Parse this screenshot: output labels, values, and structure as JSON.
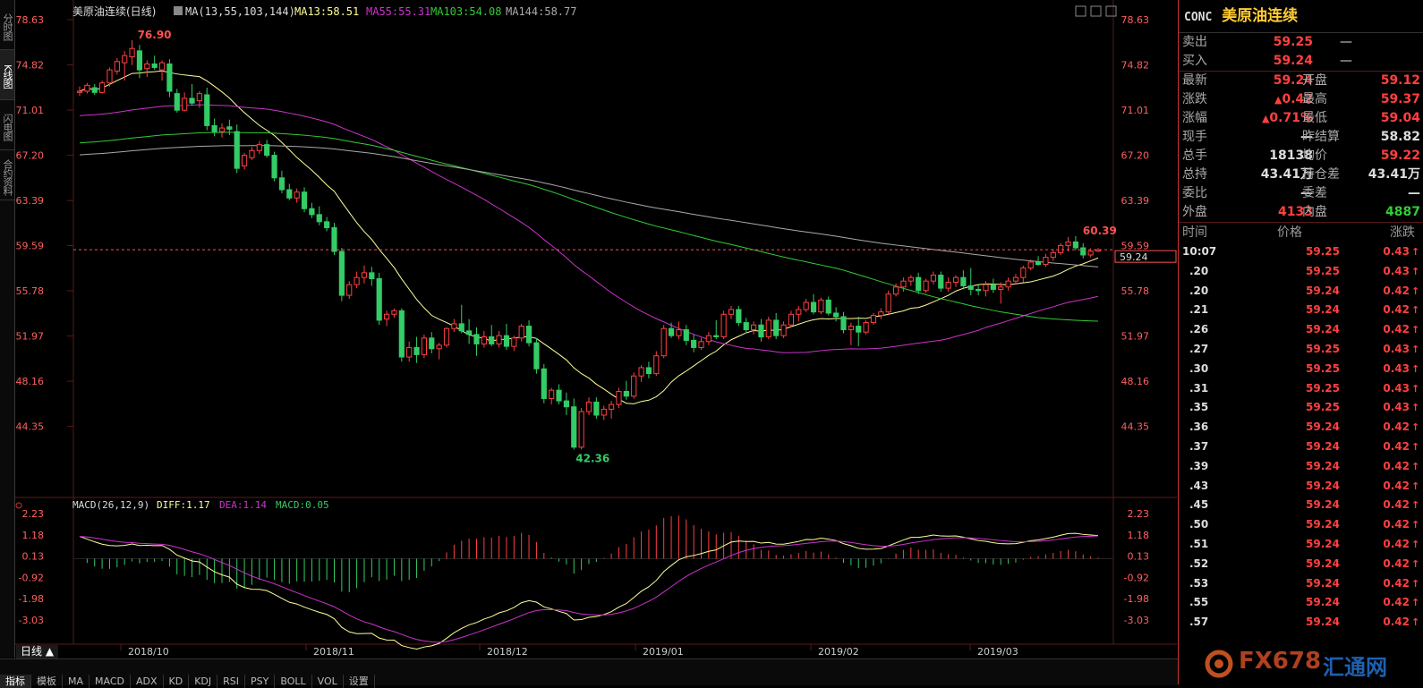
{
  "side_tabs": [
    "分时图",
    "K线图",
    "闪电图",
    "合约资料"
  ],
  "main_legend": {
    "name": "美原油连续(日线)",
    "ma_label": "MA(13,55,103,144)",
    "ma13": "MA13:58.51",
    "ma55": "MA55:55.31",
    "ma103": "MA103:54.08",
    "ma144": "MA144:58.77"
  },
  "macd_legend": {
    "label": "MACD(26,12,9)",
    "diff": "DIFF:1.17",
    "dea": "DEA:1.14",
    "macd": "MACD:0.05"
  },
  "colors": {
    "up": "#ff4040",
    "down": "#33cc66",
    "ma13": "#ffff99",
    "ma55": "#cc33cc",
    "ma103": "#33cc33",
    "ma144": "#aaaaaa",
    "dea": "#cc33cc",
    "diff": "#ffff99"
  },
  "chart_data": {
    "type": "candlestick",
    "price_axis": {
      "ticks": [
        "78.63",
        "74.82",
        "71.01",
        "67.20",
        "63.39",
        "59.59",
        "55.78",
        "51.97",
        "48.16",
        "44.35"
      ],
      "ylim": [
        42.36,
        78.63
      ]
    },
    "macd_axis": {
      "ticks": [
        "2.23",
        "1.18",
        "0.13",
        "-0.92",
        "-1.98",
        "-3.03"
      ],
      "ylim": [
        -3.03,
        2.23
      ]
    },
    "x_labels": [
      "2018/10",
      "2018/11",
      "2018/12",
      "2019/01",
      "2019/02",
      "2019/03"
    ],
    "annotations": {
      "high": "76.90",
      "low": "42.36",
      "recent_high": "60.39",
      "last_price": "59.24"
    },
    "candles": [
      [
        72.5,
        73.0,
        72.2,
        72.6
      ],
      [
        72.6,
        73.3,
        72.4,
        73.1
      ],
      [
        72.9,
        73.2,
        72.3,
        72.5
      ],
      [
        72.5,
        73.5,
        72.4,
        73.3
      ],
      [
        73.3,
        74.6,
        73.0,
        74.4
      ],
      [
        74.3,
        75.4,
        74.0,
        75.1
      ],
      [
        75.0,
        76.0,
        73.5,
        75.6
      ],
      [
        75.5,
        76.9,
        74.8,
        76.2
      ],
      [
        76.0,
        76.5,
        73.7,
        74.4
      ],
      [
        74.5,
        75.2,
        73.8,
        74.9
      ],
      [
        74.9,
        75.6,
        74.4,
        74.6
      ],
      [
        74.4,
        75.2,
        73.5,
        75.0
      ],
      [
        74.9,
        75.3,
        72.1,
        72.6
      ],
      [
        72.4,
        72.8,
        70.8,
        71.0
      ],
      [
        71.0,
        72.5,
        70.9,
        72.0
      ],
      [
        72.0,
        73.2,
        71.4,
        71.6
      ],
      [
        71.8,
        72.6,
        71.2,
        72.4
      ],
      [
        72.3,
        72.9,
        69.3,
        69.7
      ],
      [
        69.7,
        70.3,
        68.8,
        69.2
      ],
      [
        69.2,
        69.9,
        68.7,
        69.5
      ],
      [
        69.6,
        70.2,
        68.9,
        69.4
      ],
      [
        69.2,
        69.8,
        65.7,
        66.1
      ],
      [
        66.3,
        67.4,
        66.0,
        67.2
      ],
      [
        67.0,
        67.9,
        66.8,
        67.6
      ],
      [
        67.6,
        68.4,
        67.3,
        68.1
      ],
      [
        68.1,
        68.5,
        67.0,
        67.2
      ],
      [
        67.2,
        67.5,
        65.0,
        65.3
      ],
      [
        65.3,
        65.9,
        64.0,
        64.3
      ],
      [
        64.3,
        64.8,
        63.4,
        63.6
      ],
      [
        63.6,
        64.4,
        63.2,
        64.1
      ],
      [
        64.1,
        64.5,
        62.4,
        62.7
      ],
      [
        62.7,
        63.2,
        61.9,
        62.2
      ],
      [
        62.2,
        62.9,
        61.3,
        61.6
      ],
      [
        61.6,
        62.0,
        60.8,
        61.1
      ],
      [
        61.1,
        61.5,
        58.8,
        59.1
      ],
      [
        59.1,
        59.4,
        54.9,
        55.4
      ],
      [
        55.4,
        56.6,
        55.1,
        56.3
      ],
      [
        56.3,
        57.4,
        56.0,
        56.9
      ],
      [
        56.9,
        57.9,
        56.4,
        57.3
      ],
      [
        57.3,
        57.8,
        56.2,
        56.8
      ],
      [
        56.8,
        57.3,
        52.9,
        53.3
      ],
      [
        53.4,
        54.1,
        52.8,
        53.8
      ],
      [
        53.8,
        54.3,
        53.5,
        54.1
      ],
      [
        54.1,
        54.3,
        49.8,
        50.2
      ],
      [
        50.2,
        51.5,
        49.8,
        51.0
      ],
      [
        51.0,
        51.9,
        49.7,
        50.4
      ],
      [
        50.4,
        52.1,
        50.1,
        51.8
      ],
      [
        51.8,
        52.3,
        50.5,
        50.9
      ],
      [
        50.9,
        51.4,
        50.0,
        51.2
      ],
      [
        51.2,
        52.7,
        51.0,
        52.6
      ],
      [
        52.6,
        53.4,
        52.3,
        53.0
      ],
      [
        53.0,
        54.6,
        52.2,
        52.4
      ],
      [
        52.4,
        53.4,
        51.3,
        52.1
      ],
      [
        52.1,
        52.7,
        50.3,
        51.3
      ],
      [
        51.3,
        52.4,
        51.0,
        51.9
      ],
      [
        51.9,
        52.9,
        51.1,
        51.3
      ],
      [
        51.3,
        52.4,
        51.0,
        52.0
      ],
      [
        52.0,
        53.0,
        50.8,
        51.1
      ],
      [
        51.1,
        52.0,
        50.7,
        51.8
      ],
      [
        51.8,
        53.0,
        51.5,
        52.8
      ],
      [
        52.8,
        53.3,
        51.1,
        51.4
      ],
      [
        51.4,
        51.8,
        48.8,
        49.2
      ],
      [
        49.2,
        49.6,
        46.3,
        46.7
      ],
      [
        46.7,
        47.6,
        46.2,
        47.4
      ],
      [
        47.4,
        47.9,
        46.2,
        46.5
      ],
      [
        46.5,
        47.2,
        45.3,
        46.0
      ],
      [
        46.0,
        46.7,
        42.4,
        42.6
      ],
      [
        42.6,
        45.9,
        42.4,
        45.6
      ],
      [
        45.6,
        46.8,
        45.3,
        46.4
      ],
      [
        46.4,
        46.8,
        45.0,
        45.3
      ],
      [
        45.3,
        46.1,
        44.9,
        45.8
      ],
      [
        45.8,
        46.5,
        45.0,
        46.2
      ],
      [
        46.2,
        47.6,
        45.9,
        47.3
      ],
      [
        47.3,
        48.2,
        46.6,
        46.9
      ],
      [
        46.9,
        48.9,
        46.7,
        48.6
      ],
      [
        48.6,
        49.5,
        48.1,
        49.3
      ],
      [
        49.3,
        49.8,
        48.4,
        48.8
      ],
      [
        48.8,
        50.7,
        48.6,
        50.3
      ],
      [
        50.3,
        52.9,
        50.1,
        52.6
      ],
      [
        52.6,
        53.1,
        51.8,
        52.0
      ],
      [
        52.0,
        53.2,
        51.7,
        52.5
      ],
      [
        52.5,
        52.9,
        51.2,
        51.6
      ],
      [
        51.6,
        52.1,
        50.6,
        51.0
      ],
      [
        51.0,
        51.8,
        50.8,
        51.5
      ],
      [
        51.5,
        52.3,
        51.2,
        52.0
      ],
      [
        52.0,
        53.3,
        51.7,
        51.9
      ],
      [
        51.9,
        54.1,
        51.7,
        53.8
      ],
      [
        53.8,
        54.5,
        53.4,
        54.2
      ],
      [
        54.2,
        54.5,
        52.8,
        53.1
      ],
      [
        53.1,
        53.5,
        52.2,
        52.5
      ],
      [
        52.5,
        53.2,
        52.1,
        52.9
      ],
      [
        52.9,
        53.4,
        51.5,
        51.9
      ],
      [
        51.9,
        53.6,
        51.7,
        53.3
      ],
      [
        53.3,
        53.9,
        51.7,
        52.0
      ],
      [
        52.0,
        53.2,
        51.8,
        52.9
      ],
      [
        52.9,
        54.1,
        52.7,
        53.8
      ],
      [
        53.8,
        54.5,
        53.2,
        54.2
      ],
      [
        54.2,
        55.1,
        54.0,
        54.8
      ],
      [
        54.8,
        55.5,
        53.8,
        54.0
      ],
      [
        54.0,
        55.2,
        53.8,
        55.0
      ],
      [
        55.0,
        55.3,
        53.7,
        53.9
      ],
      [
        53.9,
        54.4,
        53.2,
        53.6
      ],
      [
        53.6,
        54.0,
        52.2,
        52.5
      ],
      [
        52.5,
        53.1,
        51.2,
        52.8
      ],
      [
        52.8,
        53.6,
        51.1,
        52.3
      ],
      [
        52.3,
        53.3,
        52.1,
        53.1
      ],
      [
        53.1,
        53.9,
        52.9,
        53.7
      ],
      [
        53.7,
        54.3,
        53.4,
        54.0
      ],
      [
        54.0,
        55.8,
        53.8,
        55.5
      ],
      [
        55.5,
        56.4,
        55.3,
        56.1
      ],
      [
        56.1,
        56.9,
        55.7,
        56.6
      ],
      [
        56.6,
        57.1,
        56.2,
        56.9
      ],
      [
        56.9,
        57.3,
        55.5,
        55.8
      ],
      [
        55.8,
        56.8,
        55.6,
        56.6
      ],
      [
        56.6,
        57.4,
        56.3,
        57.1
      ],
      [
        57.1,
        57.4,
        55.7,
        56.0
      ],
      [
        56.0,
        56.9,
        55.7,
        56.5
      ],
      [
        56.5,
        57.1,
        56.1,
        56.9
      ],
      [
        56.9,
        57.5,
        55.9,
        56.2
      ],
      [
        56.2,
        57.7,
        55.4,
        55.9
      ],
      [
        55.9,
        56.3,
        55.4,
        55.8
      ],
      [
        55.8,
        56.6,
        55.3,
        56.3
      ],
      [
        56.3,
        56.8,
        55.6,
        55.9
      ],
      [
        55.9,
        56.5,
        54.7,
        56.1
      ],
      [
        56.1,
        56.9,
        55.8,
        56.6
      ],
      [
        56.6,
        57.2,
        56.3,
        56.9
      ],
      [
        56.9,
        57.9,
        56.5,
        57.7
      ],
      [
        57.7,
        58.4,
        57.5,
        58.2
      ],
      [
        58.2,
        58.7,
        57.9,
        58.0
      ],
      [
        58.0,
        58.9,
        57.8,
        58.6
      ],
      [
        58.6,
        59.3,
        58.3,
        59.0
      ],
      [
        59.0,
        59.8,
        58.8,
        59.6
      ],
      [
        59.6,
        60.3,
        59.1,
        59.9
      ],
      [
        59.9,
        60.39,
        59.2,
        59.4
      ],
      [
        59.4,
        59.8,
        58.5,
        58.8
      ],
      [
        58.8,
        59.37,
        58.6,
        59.12
      ],
      [
        59.12,
        59.37,
        59.04,
        59.24
      ]
    ]
  },
  "quote": {
    "code": "CONC",
    "name": "美原油连续",
    "sell_label": "卖出",
    "sell": "59.25",
    "sell_vol": "—",
    "buy_label": "买入",
    "buy": "59.24",
    "buy_vol": "—",
    "rows": [
      {
        "l1": "最新",
        "v1": "59.24",
        "c1": "red",
        "l2": "开盘",
        "v2": "59.12",
        "c2": "red"
      },
      {
        "l1": "涨跌",
        "v1": "0.42",
        "c1": "red",
        "arrow1": true,
        "l2": "最高",
        "v2": "59.37",
        "c2": "red"
      },
      {
        "l1": "涨幅",
        "v1": "0.71%",
        "c1": "red",
        "arrow1": true,
        "l2": "最低",
        "v2": "59.04",
        "c2": "red"
      },
      {
        "l1": "现手",
        "v1": "—",
        "c1": "white",
        "l2": "昨结算",
        "v2": "58.82",
        "c2": "white"
      },
      {
        "l1": "总手",
        "v1": "18138",
        "c1": "white",
        "l2": "均价",
        "v2": "59.22",
        "c2": "red"
      },
      {
        "l1": "总持",
        "v1": "43.41万",
        "c1": "white",
        "l2": "持仓差",
        "v2": "43.41万",
        "c2": "white"
      },
      {
        "l1": "委比",
        "v1": "—",
        "c1": "white",
        "l2": "委差",
        "v2": "—",
        "c2": "white"
      },
      {
        "l1": "外盘",
        "v1": "4133",
        "c1": "red",
        "l2": "内盘",
        "v2": "4887",
        "c2": "green"
      }
    ],
    "ticks_header": {
      "time": "时间",
      "price": "价格",
      "change": "涨跌"
    },
    "ticks": [
      {
        "t": "10:07",
        "p": "59.25",
        "c": "0.43"
      },
      {
        "t": ".20",
        "p": "59.25",
        "c": "0.43"
      },
      {
        "t": ".20",
        "p": "59.24",
        "c": "0.42"
      },
      {
        "t": ".21",
        "p": "59.24",
        "c": "0.42"
      },
      {
        "t": ".26",
        "p": "59.24",
        "c": "0.42"
      },
      {
        "t": ".27",
        "p": "59.25",
        "c": "0.43"
      },
      {
        "t": ".30",
        "p": "59.25",
        "c": "0.43"
      },
      {
        "t": ".31",
        "p": "59.25",
        "c": "0.43"
      },
      {
        "t": ".35",
        "p": "59.25",
        "c": "0.43"
      },
      {
        "t": ".36",
        "p": "59.24",
        "c": "0.42"
      },
      {
        "t": ".37",
        "p": "59.24",
        "c": "0.42"
      },
      {
        "t": ".39",
        "p": "59.24",
        "c": "0.42"
      },
      {
        "t": ".43",
        "p": "59.24",
        "c": "0.42"
      },
      {
        "t": ".45",
        "p": "59.24",
        "c": "0.42"
      },
      {
        "t": ".50",
        "p": "59.24",
        "c": "0.42"
      },
      {
        "t": ".51",
        "p": "59.24",
        "c": "0.42"
      },
      {
        "t": ".52",
        "p": "59.24",
        "c": "0.42"
      },
      {
        "t": ".53",
        "p": "59.24",
        "c": "0.42"
      },
      {
        "t": ".55",
        "p": "59.24",
        "c": "0.42"
      },
      {
        "t": ".57",
        "p": "59.24",
        "c": "0.42"
      }
    ]
  },
  "bottom": {
    "period": "日线 ▲",
    "tabs": [
      "指标",
      "模板",
      "MA",
      "MACD",
      "ADX",
      "KD",
      "KDJ",
      "RSI",
      "PSY",
      "BOLL",
      "VOL",
      "设置"
    ]
  },
  "watermark": {
    "text1": "FX678",
    "text2": "汇通网"
  }
}
